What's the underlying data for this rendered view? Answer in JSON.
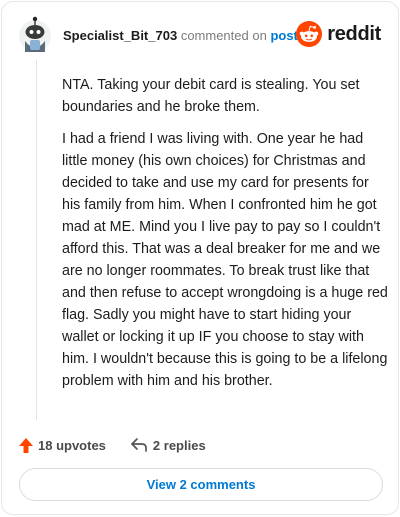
{
  "header": {
    "username": "Specialist_Bit_703",
    "action_text": "commented on",
    "post_link": "post",
    "logo_text": "reddit"
  },
  "comment": {
    "paragraphs": [
      "NTA. Taking your debit card is stealing. You set boundaries and he broke them.",
      "I had a friend I was living with. One year he had little money (his own choices) for Christmas and decided to take and use my card for presents for his family from him. When I confronted him he got mad at ME. Mind you I live pay to pay so I couldn't afford this. That was a deal breaker for me and we are no longer roommates. To break trust like that and then refuse to accept wrongdoing is a huge red flag. Sadly you might have to start hiding your wallet or locking it up IF you choose to stay with him. I wouldn't because this is going to be a lifelong problem with him and his brother."
    ]
  },
  "actions": {
    "upvotes_label": "18 upvotes",
    "replies_label": "2 replies"
  },
  "footer": {
    "view_comments_label": "View 2 comments"
  },
  "colors": {
    "upvote_accent": "#ff4500",
    "link_blue": "#0079d3",
    "reddit_orange": "#ff4500"
  },
  "icons": {
    "avatar": "snoo-avatar",
    "logo": "reddit-snoo-icon",
    "upvote": "upvote-arrow-icon",
    "reply": "reply-arrow-icon"
  }
}
